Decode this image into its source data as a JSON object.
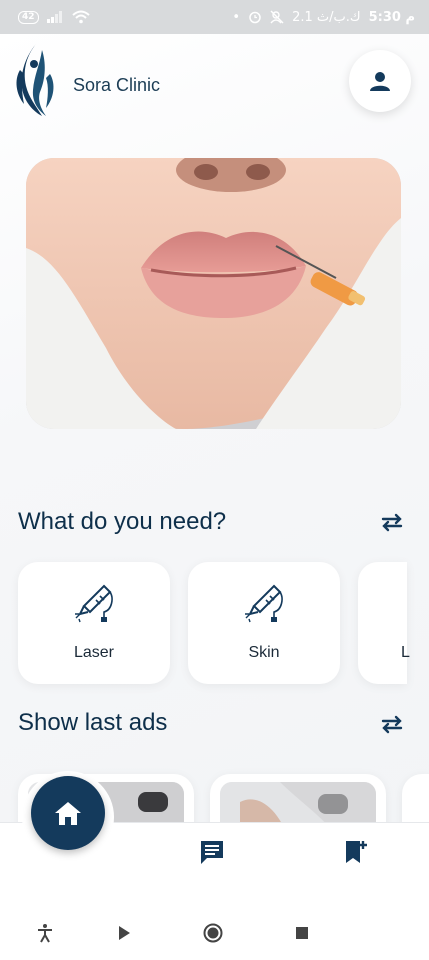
{
  "status_bar": {
    "battery_label": "42",
    "time": "5:30 م",
    "network_label": "2.1 ك.ب/ث"
  },
  "header": {
    "clinic_name": "Sora Clinic"
  },
  "sections": {
    "needs_title": "What do you need?",
    "ads_title": "Show last ads"
  },
  "categories": [
    {
      "label": "Laser"
    },
    {
      "label": "Skin"
    },
    {
      "label": "L"
    }
  ],
  "icons": {
    "logo": "sora-clinic-logo",
    "profile": "person-icon",
    "swap": "swap-arrows-icon",
    "category": "laser-pen-icon",
    "home": "home-icon",
    "chat": "chat-icon",
    "bookmark": "bookmark-add-icon"
  },
  "colors": {
    "primary": "#143a5c",
    "text": "#0e2f4a",
    "status_bar": "#d8dadc"
  }
}
